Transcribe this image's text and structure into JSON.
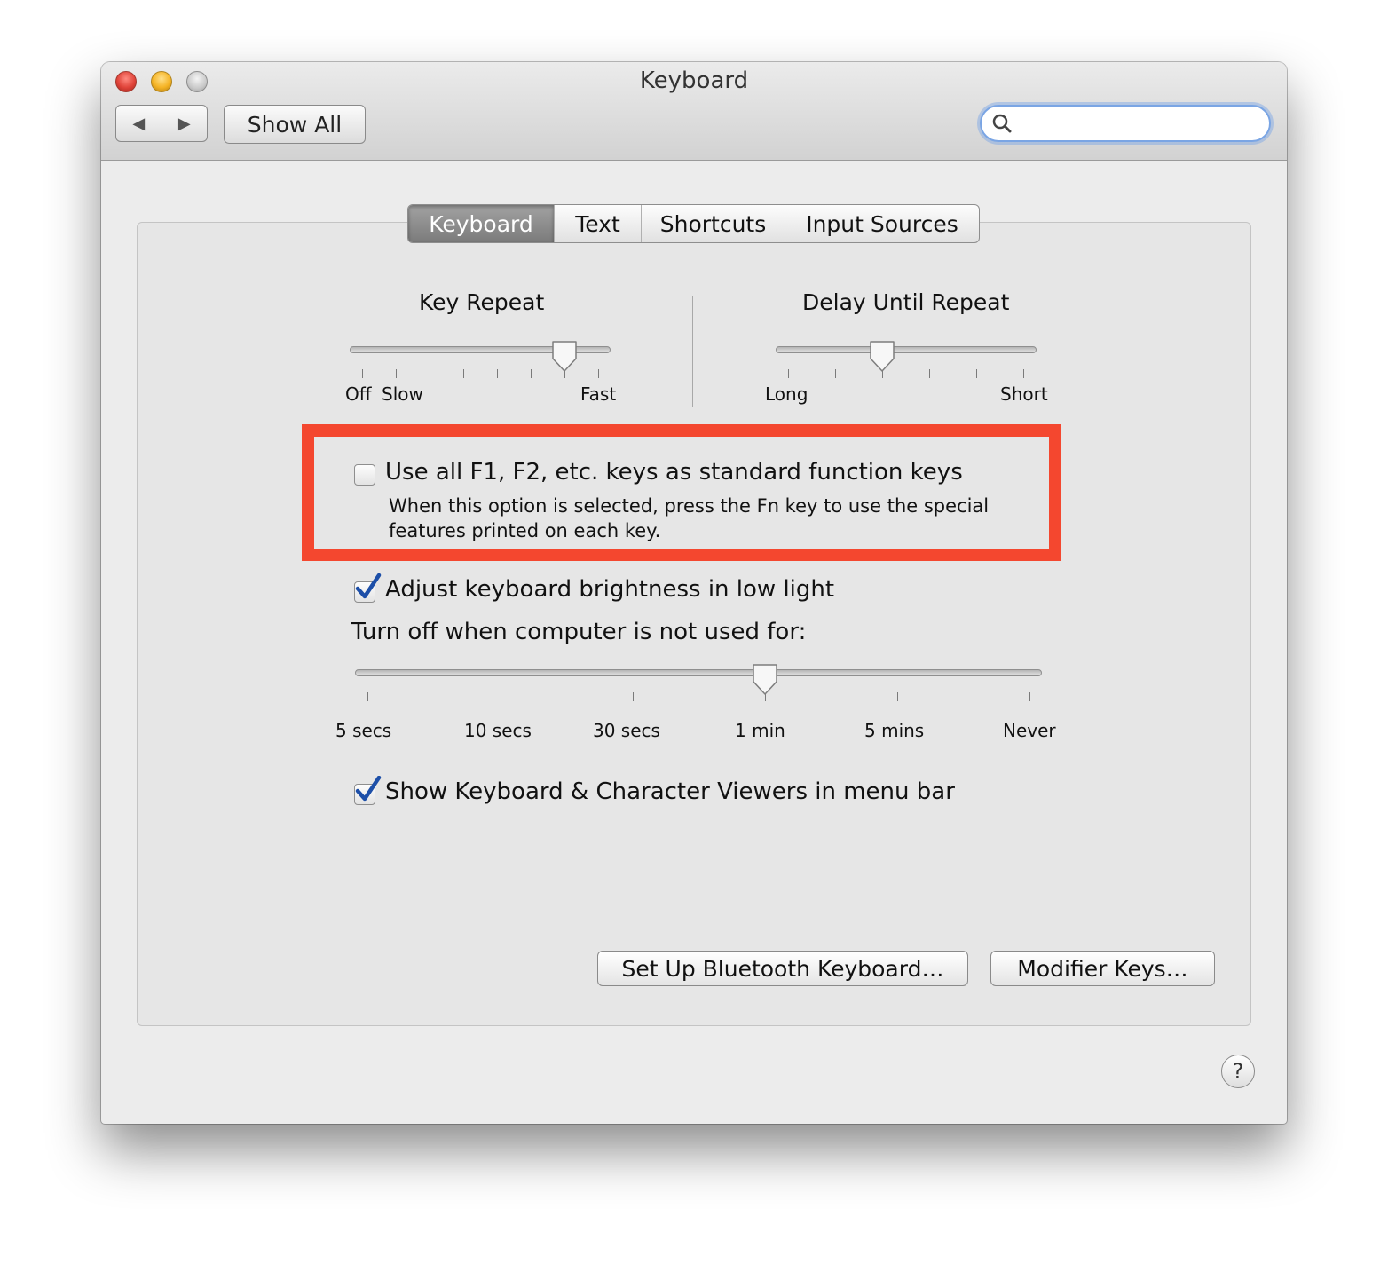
{
  "window": {
    "title": "Keyboard"
  },
  "toolbar": {
    "back_icon": "◀",
    "forward_icon": "▶",
    "show_all_label": "Show All",
    "search_placeholder": ""
  },
  "tabs": [
    {
      "label": "Keyboard",
      "active": true
    },
    {
      "label": "Text",
      "active": false
    },
    {
      "label": "Shortcuts",
      "active": false
    },
    {
      "label": "Input Sources",
      "active": false
    }
  ],
  "key_repeat": {
    "title": "Key Repeat",
    "labels": {
      "off": "Off",
      "slow": "Slow",
      "fast": "Fast"
    },
    "tick_count": 8,
    "selected_tick_index": 6
  },
  "delay_until_repeat": {
    "title": "Delay Until Repeat",
    "labels": {
      "long": "Long",
      "short": "Short"
    },
    "tick_count": 6,
    "selected_tick_index": 2
  },
  "options": {
    "function_keys": {
      "label": "Use all F1, F2, etc. keys as standard function keys",
      "description_line1": "When this option is selected, press the Fn key to use the special",
      "description_line2": "features printed on each key.",
      "checked": false
    },
    "brightness": {
      "label": "Adjust keyboard brightness in low light",
      "checked": true
    },
    "turn_off_label": "Turn off when computer is not used for:",
    "viewers": {
      "label": "Show Keyboard & Character Viewers in menu bar",
      "checked": true
    }
  },
  "turn_off_slider": {
    "ticks": [
      "5 secs",
      "10 secs",
      "30 secs",
      "1 min",
      "5 mins",
      "Never"
    ],
    "selected_tick_index": 3
  },
  "buttons": {
    "bluetooth": "Set Up Bluetooth Keyboard…",
    "modifier": "Modifier Keys…",
    "help": "?"
  },
  "colors": {
    "highlight": "#f4472f",
    "check_blue": "#1d4fa8"
  }
}
